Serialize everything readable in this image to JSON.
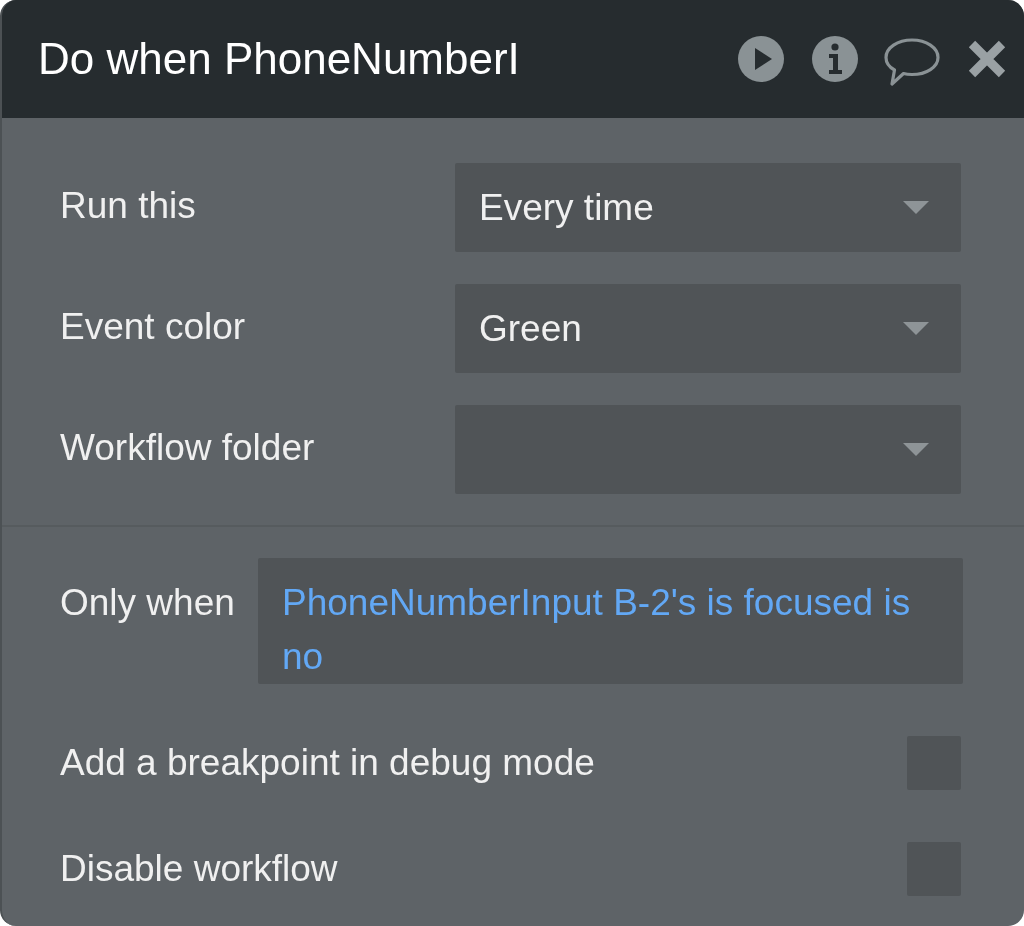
{
  "panel": {
    "title": "Do when PhoneNumberI"
  },
  "settings": [
    {
      "kind": "dropdown",
      "label": "Run this",
      "value": "Every time"
    },
    {
      "kind": "dropdown",
      "label": "Event color",
      "value": "Green"
    },
    {
      "kind": "dropdown",
      "label": "Workflow folder"
    }
  ],
  "condition": {
    "label": "Only when",
    "expression": "PhoneNumberInput B-2's is focused is no"
  },
  "options": [
    {
      "label": "Add a breakpoint in debug mode",
      "checked": false
    },
    {
      "label": "Disable workflow",
      "checked": false
    }
  ]
}
